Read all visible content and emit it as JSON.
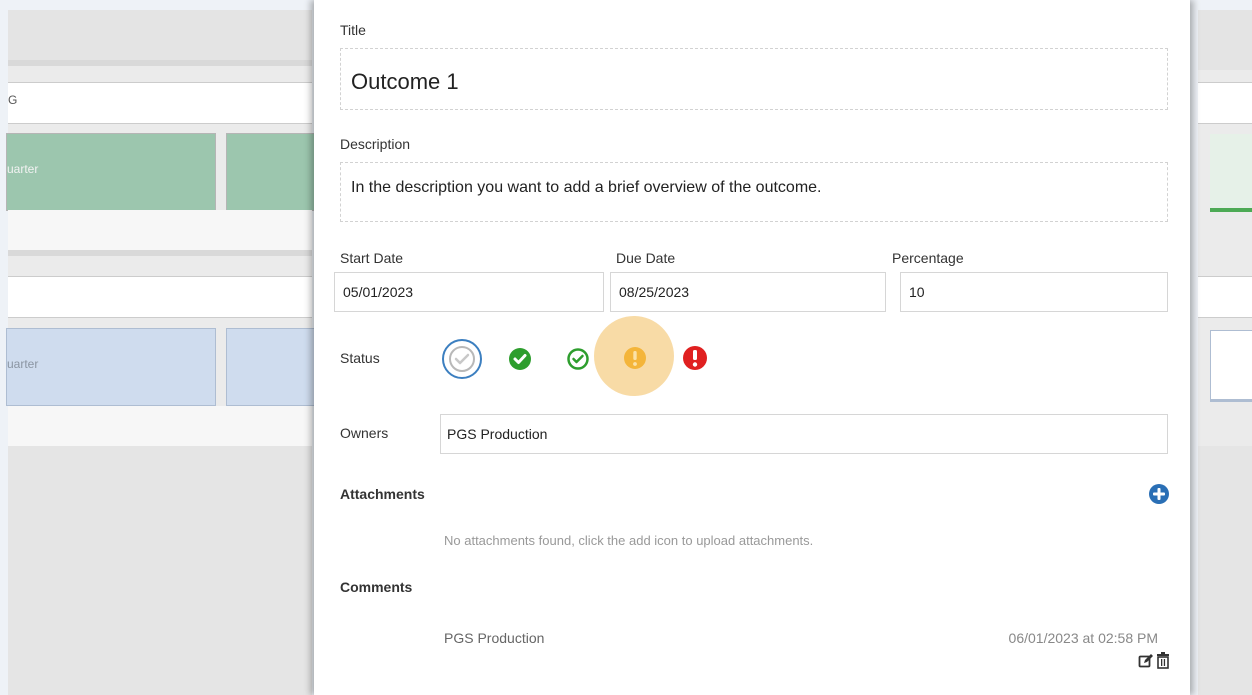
{
  "background": {
    "row1_text": "G",
    "green_card_text": "uarter",
    "blue_card_text": "uarter"
  },
  "modal": {
    "title_label": "Title",
    "title_value": "Outcome 1",
    "description_label": "Description",
    "description_value": "In the description you want to add a brief overview of the outcome.",
    "start_date_label": "Start Date",
    "start_date_value": "05/01/2023",
    "due_date_label": "Due Date",
    "due_date_value": "08/25/2023",
    "percentage_label": "Percentage",
    "percentage_value": "10",
    "status_label": "Status",
    "status_options": [
      "not-started-icon",
      "complete-icon",
      "on-track-icon",
      "at-risk-icon",
      "off-track-icon"
    ],
    "status_selected": "at-risk-icon",
    "owners_label": "Owners",
    "owners_value": "PGS Production",
    "attachments_label": "Attachments",
    "attachments_empty": "No attachments found, click the add icon to upload attachments.",
    "comments_label": "Comments",
    "comment": {
      "author": "PGS Production",
      "timestamp": "06/01/2023 at 02:58 PM"
    }
  },
  "colors": {
    "accent_blue": "#2a6fb5",
    "green": "#2e9e2e",
    "warning": "#f0a733",
    "error": "#e02020"
  }
}
